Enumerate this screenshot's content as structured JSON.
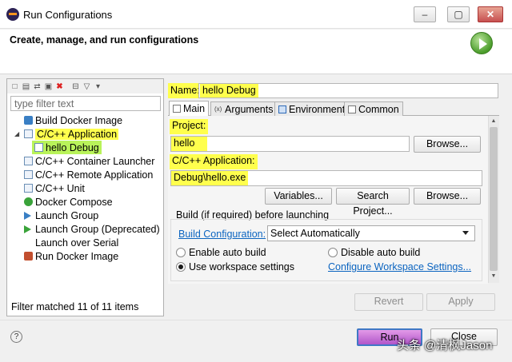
{
  "window": {
    "title": "Run Configurations",
    "minimize": "–",
    "maximize": "▢",
    "close": "✕"
  },
  "banner": {
    "title": "Create, manage, and run configurations"
  },
  "left": {
    "filter_placeholder": "type filter text",
    "tree": [
      {
        "label": "Build Docker Image"
      },
      {
        "label": "C/C++ Application",
        "expanded": true
      },
      {
        "label": "hello Debug"
      },
      {
        "label": "C/C++ Container Launcher"
      },
      {
        "label": "C/C++ Remote Application"
      },
      {
        "label": "C/C++ Unit"
      },
      {
        "label": "Docker Compose"
      },
      {
        "label": "Launch Group"
      },
      {
        "label": "Launch Group (Deprecated)"
      },
      {
        "label": "Launch over Serial"
      },
      {
        "label": "Run Docker Image"
      }
    ],
    "expander": "◢",
    "filter_status": "Filter matched 11 of 11 items"
  },
  "config": {
    "name_label": "Name:",
    "name_value": "hello Debug",
    "tabs": [
      {
        "label": "Main",
        "active": true
      },
      {
        "label": "Arguments"
      },
      {
        "label": "Environment"
      },
      {
        "label": "Common"
      }
    ],
    "project_label": "Project:",
    "project_value": "hello",
    "browse_label": "Browse...",
    "app_label": "C/C++ Application:",
    "app_value": "Debug\\hello.exe",
    "variables_label": "Variables...",
    "search_project_label": "Search Project...",
    "browse2_label": "Browse...",
    "build_group_label": "Build (if required) before launching",
    "build_config_link": "Build Configuration:",
    "build_config_value": "Select Automatically",
    "enable_auto_build": "Enable auto build",
    "disable_auto_build": "Disable auto build",
    "use_workspace": "Use workspace settings",
    "configure_workspace_link": "Configure Workspace Settings...",
    "selected_radio": "use_workspace"
  },
  "footer": {
    "revert_label": "Revert",
    "apply_label": "Apply",
    "run_label": "Run",
    "close_label": "Close",
    "help_glyph": "?"
  },
  "watermark": "头条 @清枫Jason",
  "colors": {
    "highlight_yellow": "#ffff4d",
    "highlight_green": "#b9f35a",
    "link": "#0b64c0",
    "run_button": "#c878db"
  }
}
